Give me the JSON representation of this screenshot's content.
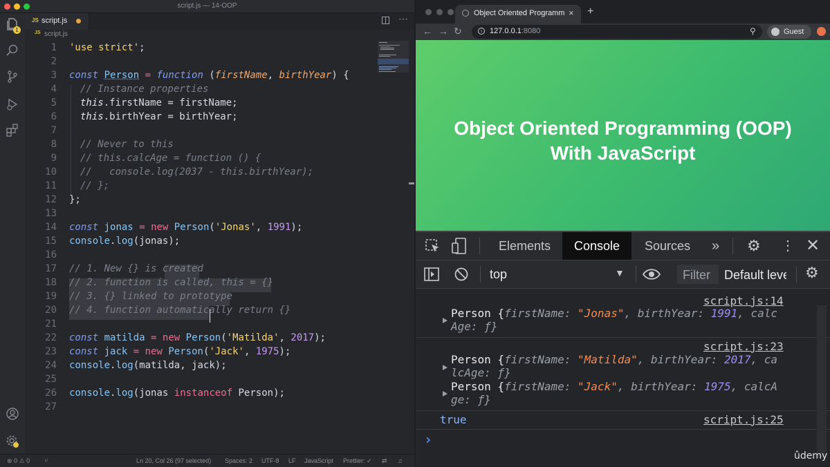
{
  "editor": {
    "window_title": "script.js — 14-OOP",
    "tab_label": "script.js",
    "tab_lang_badge": "JS",
    "breadcrumb_file": "script.js",
    "notification_count": "1",
    "line_numbers": [
      "1",
      "2",
      "3",
      "4",
      "5",
      "6",
      "7",
      "8",
      "9",
      "10",
      "11",
      "12",
      "13",
      "14",
      "15",
      "16",
      "17",
      "18",
      "19",
      "20",
      "21",
      "22",
      "23",
      "24",
      "25",
      "26",
      "27"
    ],
    "status": {
      "errors": "0",
      "warnings": "0",
      "cursor": "Ln 20, Col 26 (97 selected)",
      "spaces": "Spaces: 2",
      "encoding": "UTF-8",
      "eol": "LF",
      "language": "JavaScript",
      "prettier": "Prettier: ✓"
    },
    "tokens": {
      "use_strict": "'use strict'",
      "semicolon": ";",
      "const": "const",
      "person": "Person",
      "eq": "=",
      "function": "function",
      "paren_open": " (",
      "first_name_param": "firstName",
      "comma": ", ",
      "birth_year_param": "birthYear",
      "close_brace_open": ") {",
      "c_instance": "// Instance properties",
      "this": "this",
      "dot_first_name": ".firstName = firstName;",
      "dot_birth_year": ".birthYear = birthYear;",
      "c_never": "// Never to this",
      "c_calcage": "// this.calcAge = function () {",
      "c_console": "//   console.log(2037 - this.birthYear);",
      "c_close": "// };",
      "close_block": "};",
      "jonas": "jonas",
      "new": "new",
      "jonas_str": "'Jonas'",
      "year_1991": "1991",
      "end_call": ");",
      "console": "console",
      "log": "log",
      "dot": ".",
      "lp": "(",
      "jonas_arg": "jonas);",
      "c_step1": "// 1. New {} is created",
      "c_step2": "// 2. function is called, this = {}",
      "c_step3": "// 3. {} linked to prototype",
      "c_step4": "// 4. function automatically return {}",
      "matilda": "matilda",
      "matilda_str": "'Matilda'",
      "year_2017": "2017",
      "jack": "jack",
      "jack_str": "'Jack'",
      "year_1975": "1975",
      "log_args_mj": "matilda, jack);",
      "jonas_sp": "jonas ",
      "instanceof": "instanceof",
      "person_end": " Person);"
    }
  },
  "browser": {
    "tab_title": "Object Oriented Programming",
    "url_host": "127.0.0.1",
    "url_port": ":8080",
    "guest_label": "Guest",
    "slide_line1": "Object Oriented Programming (OOP)",
    "slide_line2": "With JavaScript"
  },
  "devtools": {
    "tabs": [
      "Elements",
      "Console",
      "Sources"
    ],
    "context": "top",
    "filter_placeholder": "Filter",
    "levels": "Default leve",
    "entries": [
      {
        "source": "script.js:14",
        "lines": [
          {
            "prefix": "Person {",
            "k1": "firstName",
            "v1": "\"Jonas\"",
            "k2": "birthYear",
            "v2": "1991",
            "tail": ", calc"
          },
          {
            "cont": "Age: ƒ}"
          }
        ]
      },
      {
        "source": "script.js:23",
        "lines": [
          {
            "prefix": "Person {",
            "k1": "firstName",
            "v1": "\"Matilda\"",
            "k2": "birthYear",
            "v2": "2017",
            "tail": ", ca"
          },
          {
            "cont": "lcAge: ƒ}"
          },
          {
            "prefix": "Person {",
            "k1": "firstName",
            "v1": "\"Jack\"",
            "k2": "birthYear",
            "v2": "1975",
            "tail": ", calcA"
          },
          {
            "cont": "ge: ƒ}"
          }
        ]
      },
      {
        "source": "script.js:25",
        "value": "true"
      }
    ],
    "prompt": "›"
  },
  "watermark": "ûdemy",
  "colors": {
    "editor_bg": "#26272b",
    "slide_green": "#3dbb6e",
    "console_true": "#8ab4f8"
  }
}
